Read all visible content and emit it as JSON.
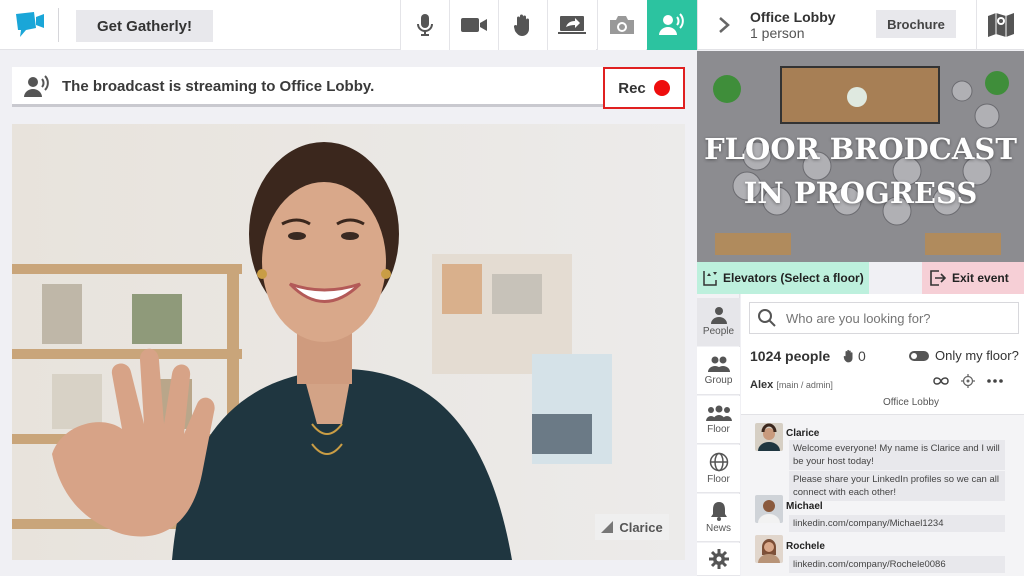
{
  "topbar": {
    "get_label": "Get Gatherly!",
    "tools": [
      "microphone-icon",
      "video-camera-icon",
      "raise-hand-icon",
      "share-screen-icon",
      "photo-camera-icon",
      "broadcast-icon"
    ]
  },
  "room": {
    "name": "Office Lobby",
    "count": "1 person",
    "brochure_label": "Brochure"
  },
  "broadcast": {
    "message": "The broadcast is streaming to Office Lobby.",
    "rec_label": "Rec"
  },
  "video": {
    "speaker_name": "Clarice"
  },
  "floor": {
    "title_line1": "FLOOR BRODCAST",
    "title_line2": "IN PROGRESS",
    "elevators_label": "Elevators (Select a floor)",
    "exit_label": "Exit event"
  },
  "sidenav": {
    "items": [
      {
        "label": "People",
        "icon": "person-icon"
      },
      {
        "label": "Group",
        "icon": "group-icon"
      },
      {
        "label": "Floor",
        "icon": "floor-people-icon"
      },
      {
        "label": "Floor",
        "icon": "globe-icon"
      },
      {
        "label": "News",
        "icon": "bell-icon"
      },
      {
        "label": "",
        "icon": "gear-icon"
      }
    ]
  },
  "people": {
    "search_placeholder": "Who are you looking for?",
    "count_label": "1024 people",
    "hands_count": "0",
    "only_floor_label": "Only my floor?",
    "admin_name": "Alex",
    "admin_role": "[main / admin]",
    "admin_location": "Office Lobby"
  },
  "feed": [
    {
      "author": "Clarice",
      "messages": [
        "Welcome everyone! My name is Clarice and I will be your host today!",
        "Please share your LinkedIn profiles so we can all connect with each other!"
      ]
    },
    {
      "author": "Michael",
      "messages": [
        "linkedin.com/company/Michael1234"
      ]
    },
    {
      "author": "Rochele",
      "messages": [
        "linkedin.com/company/Rochele0086"
      ]
    }
  ],
  "colors": {
    "accent": "#2cc3a0",
    "rec": "#ee0d0d",
    "elevators_bg": "#bdf0dd",
    "exit_bg": "#f6cfd6"
  }
}
